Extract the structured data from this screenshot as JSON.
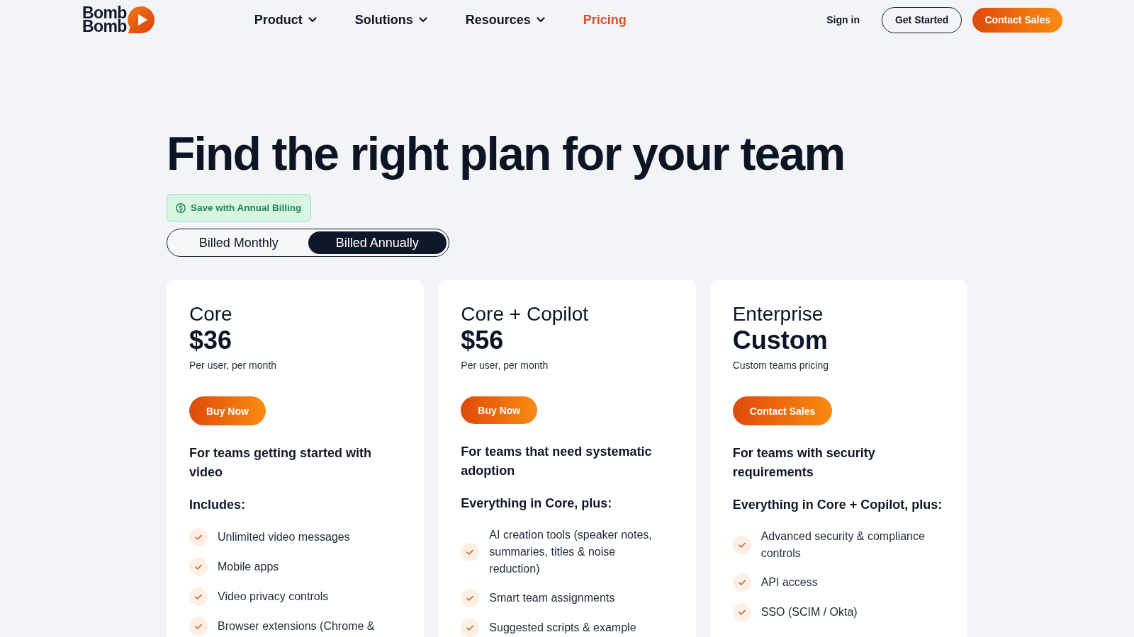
{
  "header": {
    "logo": [
      "Bomb",
      "Bomb"
    ],
    "nav": [
      {
        "label": "Product",
        "dropdown": true,
        "selected": false
      },
      {
        "label": "Solutions",
        "dropdown": true,
        "selected": false
      },
      {
        "label": "Resources",
        "dropdown": true,
        "selected": false
      },
      {
        "label": "Pricing",
        "dropdown": false,
        "selected": true
      }
    ],
    "sign_in": "Sign in",
    "buttons": [
      {
        "label": "Get Started",
        "kind": "outline"
      },
      {
        "label": "Contact Sales",
        "kind": "primary"
      }
    ]
  },
  "hero": {
    "title": "Find the right plan for your team",
    "badge": "Save with Annual Billing",
    "billing_options": [
      {
        "label": "Billed Monthly",
        "selected": false
      },
      {
        "label": "Billed Annually",
        "selected": true
      }
    ]
  },
  "plans": [
    {
      "name": "Core",
      "price": "$36",
      "price_note": "Per user, per month",
      "button": "Buy Now",
      "summary": "For teams getting started with video",
      "features_heading": "Includes:",
      "features": [
        "Unlimited video messages",
        "Mobile apps",
        "Video privacy controls",
        "Browser extensions (Chrome &"
      ]
    },
    {
      "name": "Core + Copilot",
      "price": "$56",
      "price_note": "Per user, per month",
      "button": "Buy Now",
      "summary": "For teams that need systematic adoption",
      "features_heading": "Everything in Core, plus:",
      "features": [
        "AI creation tools (speaker notes, summaries, titles & noise reduction)",
        "Smart team assignments",
        "Suggested scripts & example"
      ]
    },
    {
      "name": "Enterprise",
      "price": "Custom",
      "price_note": "Custom teams pricing",
      "button": "Contact Sales",
      "summary": "For teams with security requirements",
      "features_heading": "Everything in Core + Copilot, plus:",
      "features": [
        "Advanced security & compliance controls",
        "API access",
        "SSO (SCIM / Okta)"
      ]
    }
  ]
}
